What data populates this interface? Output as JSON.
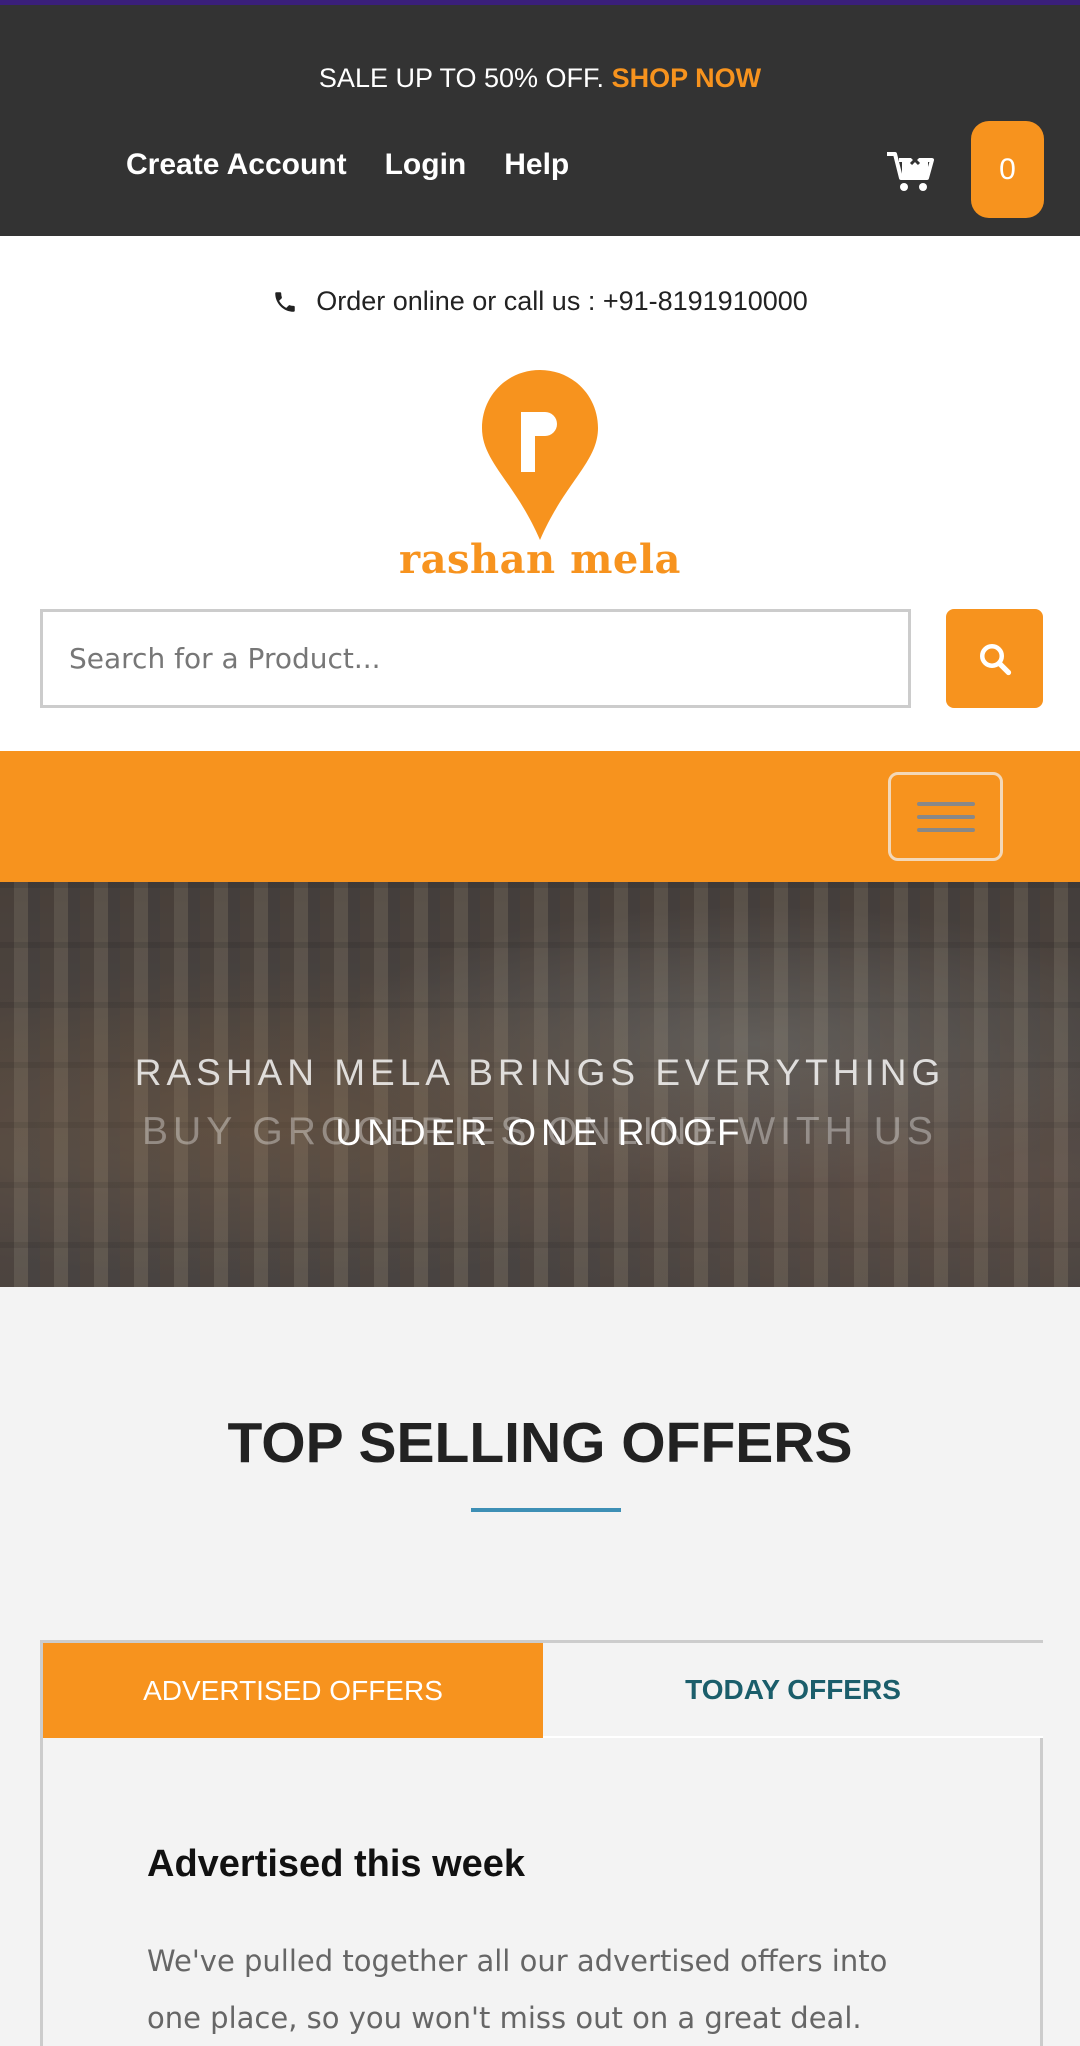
{
  "topbar": {
    "sale_text": "SALE UP TO 50% OFF.",
    "shop_now": "SHOP NOW",
    "links": [
      "Create Account",
      "Login",
      "Help"
    ],
    "cart_count": "0"
  },
  "header": {
    "phone_text": "Order online or call us : +91-8191910000",
    "logo_text": "rashan mela",
    "search_placeholder": "Search for a Product..."
  },
  "hero": {
    "line1": "RASHAN MELA BRINGS EVERYTHING",
    "line2": "UNDER ONE ROOF",
    "ghost_text": "BUY GROCERIES ONLINE WITH US"
  },
  "offers": {
    "title": "TOP SELLING OFFERS",
    "tabs": [
      "ADVERTISED OFFERS",
      "TODAY OFFERS"
    ],
    "panel_title": "Advertised this week",
    "panel_text": "We've pulled together all our advertised offers into one place, so you won't miss out on a great deal."
  },
  "colors": {
    "accent": "#f7931e",
    "topbar": "#333333",
    "underline": "#3d8fb5"
  },
  "icons": [
    "cart-icon",
    "phone-icon",
    "search-icon",
    "hamburger-icon",
    "logo-pin-icon"
  ]
}
